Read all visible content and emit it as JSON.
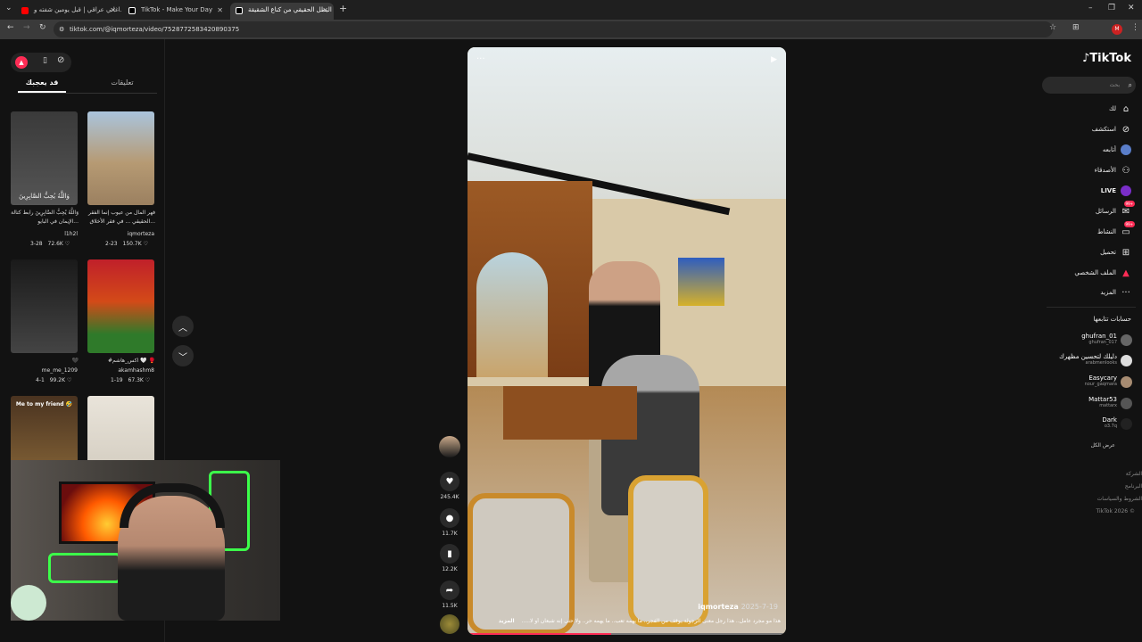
{
  "browser": {
    "tabs": [
      {
        "title": "اغاني عراقي | قبل يومين شفته و..."
      },
      {
        "title": "TikTok - Make Your Day"
      },
      {
        "title": "البطل الحقيقي من كناع الشقيقة"
      }
    ],
    "url": "tiktok.com/@iqmorteza/video/7528772583420890375"
  },
  "left_panel": {
    "tabs": [
      "قد يعجبك",
      "تعليقات"
    ],
    "videos": [
      {
        "caption": "وَاللَّهُ يُحِبُّ الصَّابِرِينَ رابط كتالة الإيمان في البايو...",
        "author": "l1h2l",
        "date": "3-28",
        "likes": "72.6K"
      },
      {
        "caption": "فهر المال من عيوب إنما الفقر الحقيقي ... في فقر الأخلاق...",
        "author": "iqmorteza",
        "date": "2-23",
        "likes": "150.7K"
      },
      {
        "caption": "🖤",
        "author": "me_me_1209",
        "date": "4-1",
        "likes": "99.2K"
      },
      {
        "caption": "#اكس_هاشم 🤍 🥊",
        "author": "akamhashm8",
        "date": "1-19",
        "likes": "67.3K"
      },
      {
        "caption": "Me to my friend 🤣",
        "author": "",
        "date": "",
        "likes": ""
      }
    ]
  },
  "video": {
    "author": "iqmorteza",
    "date": "2025-7-19",
    "caption": "هذا مو مجرد عامل.. هذا رجل معنى الرجولة.يوقف من الفجر.. ما يهمه تعب.. ما يهمه حر.. ولا حتى إنه شبعان أو لا.....",
    "more": "المزيد"
  },
  "actions": [
    {
      "icon": "heart-icon",
      "count": "245.4K"
    },
    {
      "icon": "comment-icon",
      "count": "11.7K"
    },
    {
      "icon": "bookmark-icon",
      "count": "12.2K"
    },
    {
      "icon": "share-icon",
      "count": "11.5K"
    }
  ],
  "right_nav": {
    "brand": "TikTok",
    "search_placeholder": "بحث",
    "items": [
      {
        "label": "لك",
        "icon": "home-icon"
      },
      {
        "label": "استكشف",
        "icon": "compass-icon"
      },
      {
        "label": "أتابعه",
        "icon": "following-icon"
      },
      {
        "label": "الأصدقاء",
        "icon": "friends-icon"
      },
      {
        "label": "LIVE",
        "icon": "live-icon"
      },
      {
        "label": "الرسائل",
        "icon": "messages-icon",
        "badge": "99+"
      },
      {
        "label": "النشاط",
        "icon": "activity-icon",
        "badge": "99+"
      },
      {
        "label": "تحميل",
        "icon": "upload-icon"
      },
      {
        "label": "الملف الشخصي",
        "icon": "profile-icon"
      },
      {
        "label": "المزيد",
        "icon": "more-icon"
      }
    ],
    "following_title": "حسابات تتابعها",
    "following": [
      {
        "name": "ghufran_01",
        "handle": "ghufran_017"
      },
      {
        "name": "دليلك لتحسين مظهرك",
        "handle": "arabmenlooks"
      },
      {
        "name": "Easycary",
        "handle": "nour_gaqmara"
      },
      {
        "name": "Mattar53",
        "handle": "mattarx"
      },
      {
        "name": "Dark",
        "handle": "o3.7q"
      }
    ],
    "show_all": "عرض الكل",
    "footer": [
      "الشركة",
      "البرنامج",
      "الشروط والسياسات",
      "TikTok 2026 ©"
    ]
  },
  "colors": {
    "accent": "#fe2c55",
    "bg": "#121212"
  }
}
